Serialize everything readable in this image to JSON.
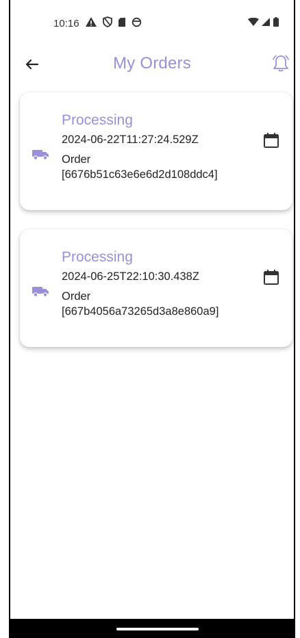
{
  "theme": {
    "accent": "#9b8fd8"
  },
  "status_bar": {
    "time": "10:16",
    "left_icons": [
      "warning-icon",
      "shield-icon",
      "sd-card-icon",
      "circle-status-icon"
    ],
    "right_icons": [
      "wifi-icon",
      "signal-icon",
      "battery-icon"
    ]
  },
  "app_bar": {
    "title": "My Orders",
    "back_icon": "arrow-left-icon",
    "notification_icon": "bell-icon"
  },
  "orders": [
    {
      "status": "Processing",
      "date": "2024-06-22T11:27:24.529Z",
      "order_line1": "Order",
      "order_line2": "[6676b51c63e6e6d2d108ddc4]",
      "icon": "truck-icon",
      "action_icon": "calendar-icon"
    },
    {
      "status": "Processing",
      "date": "2024-06-25T22:10:30.438Z",
      "order_line1": "Order",
      "order_line2": "[667b4056a73265d3a8e860a9]",
      "icon": "truck-icon",
      "action_icon": "calendar-icon"
    }
  ]
}
